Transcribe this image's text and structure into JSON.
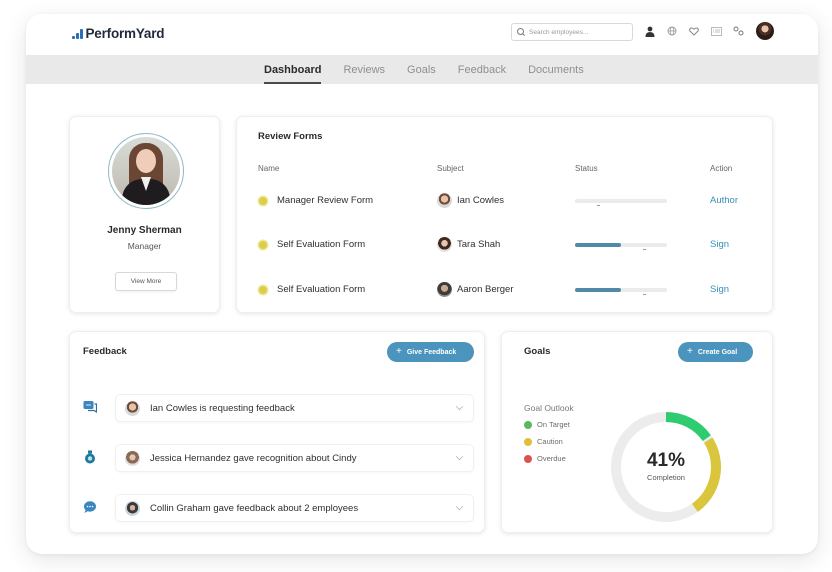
{
  "app": {
    "brand": "PerformYard",
    "brand_color": "#2c6fb6",
    "accent_color": "#4a94be"
  },
  "header": {
    "search": {
      "placeholder": "Search employees...",
      "value": ""
    },
    "icons": [
      "person-icon",
      "globe-icon",
      "heart-icon",
      "list-icon",
      "settings-icon"
    ],
    "user_avatar": "user-avatar"
  },
  "nav": {
    "tabs": [
      {
        "label": "Dashboard",
        "active": true
      },
      {
        "label": "Reviews",
        "active": false
      },
      {
        "label": "Goals",
        "active": false
      },
      {
        "label": "Feedback",
        "active": false
      },
      {
        "label": "Documents",
        "active": false
      }
    ]
  },
  "profile": {
    "name": "Jenny Sherman",
    "role": "Manager",
    "view_more_label": "View More"
  },
  "review_forms": {
    "title": "Review Forms",
    "columns": [
      "Name",
      "Subject",
      "Status",
      "Action"
    ],
    "rows": [
      {
        "name": "Manager Review Form",
        "subject": "Ian Cowles",
        "progress": 0.0,
        "action": "Author",
        "status_color": "#d9cf4a"
      },
      {
        "name": "Self Evaluation Form",
        "subject": "Tara Shah",
        "progress": 0.5,
        "action": "Sign",
        "status_color": "#d9cf4a"
      },
      {
        "name": "Self Evaluation Form",
        "subject": "Aaron Berger",
        "progress": 0.5,
        "action": "Sign",
        "status_color": "#d9cf4a"
      }
    ]
  },
  "feedback": {
    "title": "Feedback",
    "give_button": "Give Feedback",
    "items": [
      {
        "icon": "chat-bubbles-icon",
        "text": "Ian Cowles is requesting feedback"
      },
      {
        "icon": "recognition-badge-icon",
        "text": "Jessica Hernandez gave recognition about Cindy"
      },
      {
        "icon": "message-dots-icon",
        "text": "Collin Graham gave feedback about 2 employees"
      }
    ]
  },
  "goals": {
    "title": "Goals",
    "create_button": "Create Goal",
    "outlook_title": "Goal Outlook",
    "legend": [
      {
        "label": "On Target",
        "color": "#5cb85c"
      },
      {
        "label": "Caution",
        "color": "#e0bf3a"
      },
      {
        "label": "Overdue",
        "color": "#d9534f"
      }
    ],
    "completion_pct": "41%",
    "completion_label": "Completion",
    "segments": [
      {
        "name": "On Target",
        "fraction": 0.16,
        "color": "#2ecc71"
      },
      {
        "name": "Caution",
        "fraction": 0.25,
        "color": "#d9c63c"
      }
    ],
    "track_color": "#ececec"
  }
}
